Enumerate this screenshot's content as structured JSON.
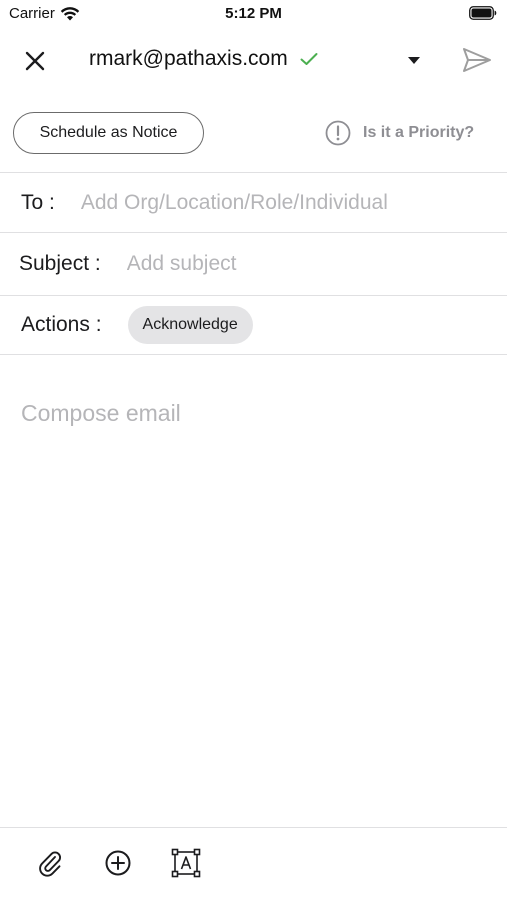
{
  "status_bar": {
    "carrier": "Carrier",
    "time": "5:12 PM"
  },
  "header": {
    "sender": "rmark@pathaxis.com",
    "verified_color": "#4caf50",
    "send_icon_color": "#9e9e9e"
  },
  "schedule": {
    "button_label": "Schedule as Notice",
    "priority_label": "Is it a Priority?"
  },
  "form": {
    "to_label": "To :",
    "to_placeholder": "Add Org/Location/Role/Individual",
    "subject_label": "Subject :",
    "subject_placeholder": "Add subject",
    "actions_label": "Actions :",
    "actions_chip": "Acknowledge",
    "compose_placeholder": "Compose email"
  },
  "toolbar": {
    "icons": [
      "paperclip-icon",
      "plus-circle-icon",
      "text-format-icon"
    ]
  }
}
